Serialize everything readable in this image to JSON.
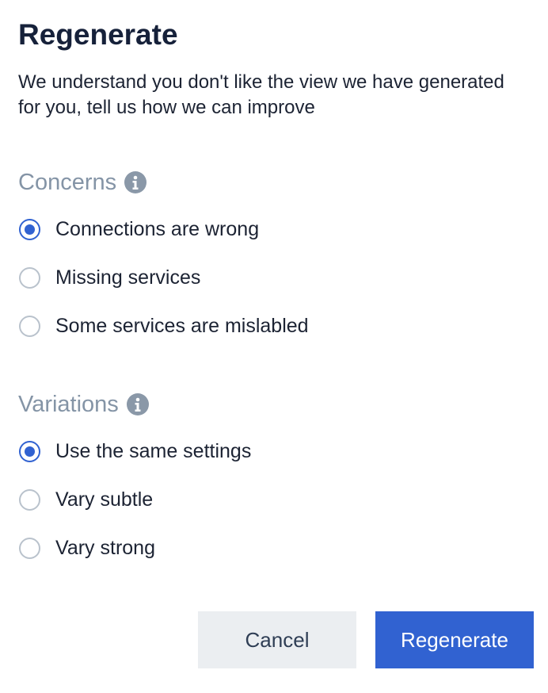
{
  "dialog": {
    "title": "Regenerate",
    "description": "We understand you don't like the view we have generated for you, tell us how we can improve"
  },
  "concerns": {
    "heading": "Concerns",
    "icon": "info-icon",
    "options": [
      {
        "label": "Connections are wrong",
        "checked": true
      },
      {
        "label": "Missing services",
        "checked": false
      },
      {
        "label": "Some services are mislabled",
        "checked": false
      }
    ]
  },
  "variations": {
    "heading": "Variations",
    "icon": "info-icon",
    "options": [
      {
        "label": "Use the same settings",
        "checked": true
      },
      {
        "label": "Vary subtle",
        "checked": false
      },
      {
        "label": "Vary strong",
        "checked": false
      }
    ]
  },
  "actions": {
    "cancel_label": "Cancel",
    "regenerate_label": "Regenerate"
  },
  "colors": {
    "accent": "#3162d1",
    "heading_muted": "#8494a6",
    "cancel_bg": "#ebeef1"
  }
}
